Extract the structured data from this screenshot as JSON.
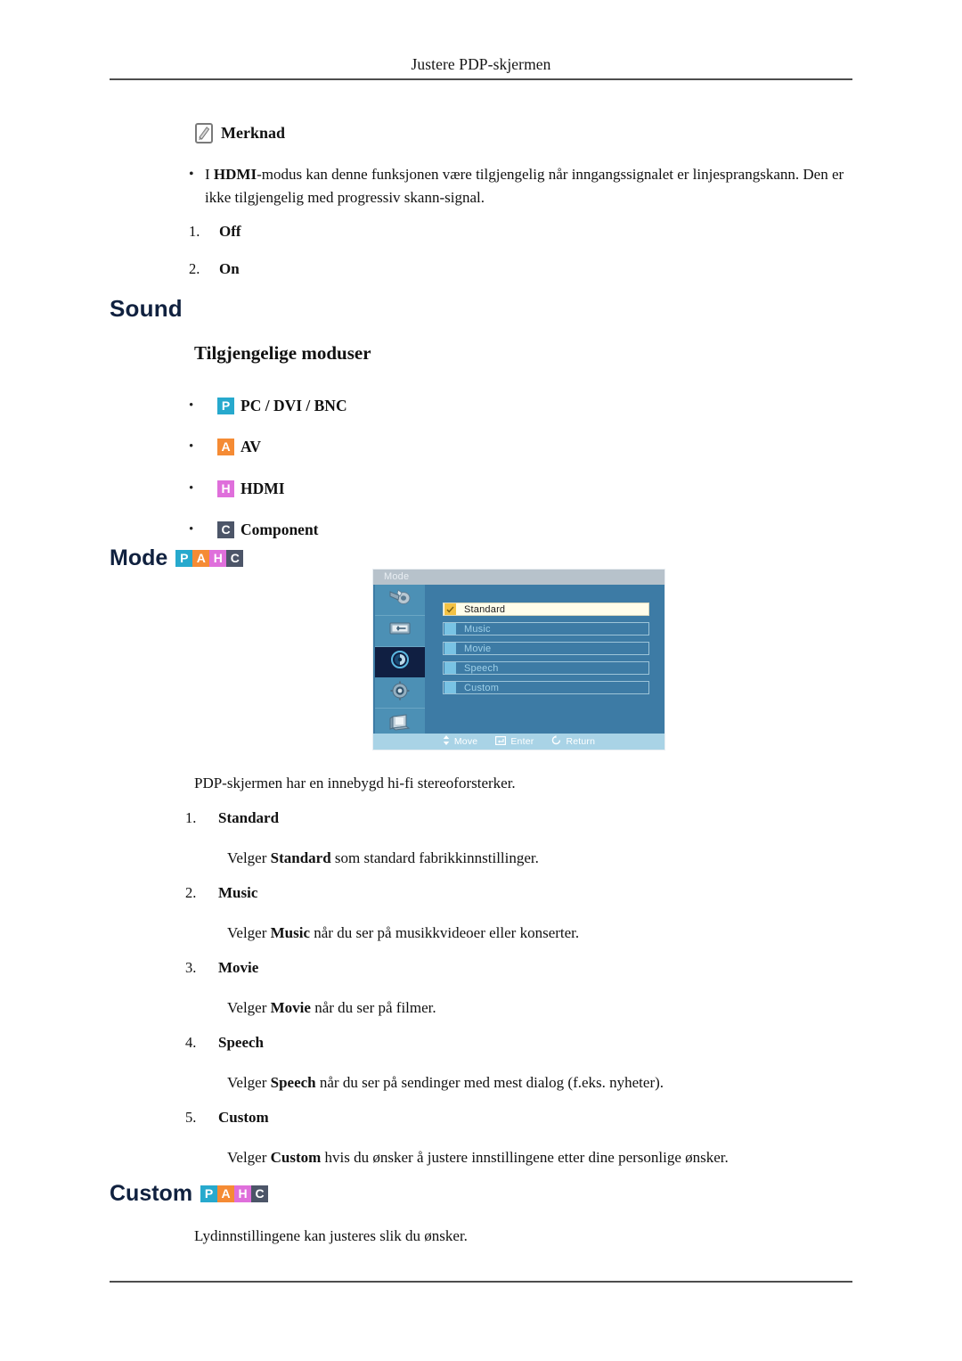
{
  "page": {
    "running_header": "Justere PDP-skjermen"
  },
  "note": {
    "icon": "note-pencil-icon",
    "label": "Merknad",
    "bullet": "I HDMI-modus kan denne funksjonen være tilgjengelig når inngangssignalet er linjesprangskann. Den er ikke tilgjengelig med progressiv skann-signal.",
    "bullet_bold_term": "HDMI",
    "options": [
      {
        "index": "1.",
        "label": "Off"
      },
      {
        "index": "2.",
        "label": "On"
      }
    ]
  },
  "sound_section": {
    "heading": "Sound",
    "subheading": "Tilgjengelige moduser",
    "available_modes": [
      {
        "badge": "P",
        "badge_color": "#27a9cd",
        "label": "PC / DVI / BNC"
      },
      {
        "badge": "A",
        "badge_color": "#f58b34",
        "label": "AV"
      },
      {
        "badge": "H",
        "badge_color": "#df6fdb",
        "label": "HDMI"
      },
      {
        "badge": "C",
        "badge_color": "#4c5568",
        "label": "Component"
      }
    ]
  },
  "mode_section": {
    "heading": "Mode",
    "badges": [
      {
        "letter": "P",
        "color": "#27a9cd"
      },
      {
        "letter": "A",
        "color": "#f58b34"
      },
      {
        "letter": "H",
        "color": "#df6fdb"
      },
      {
        "letter": "C",
        "color": "#4c5568"
      }
    ],
    "osd": {
      "title": "Mode",
      "sidebar_icons": [
        {
          "name": "picture-brush-icon",
          "active": false
        },
        {
          "name": "screen-display-icon",
          "active": false
        },
        {
          "name": "sound-speaker-icon",
          "active": true
        },
        {
          "name": "setup-gear-icon",
          "active": false
        },
        {
          "name": "multi-control-monitor-icon",
          "active": false
        }
      ],
      "items": [
        {
          "label": "Standard",
          "selected": true
        },
        {
          "label": "Music",
          "selected": false
        },
        {
          "label": "Movie",
          "selected": false
        },
        {
          "label": "Speech",
          "selected": false
        },
        {
          "label": "Custom",
          "selected": false
        }
      ],
      "footer": [
        {
          "icon": "move-updown-icon",
          "label": "Move"
        },
        {
          "icon": "enter-key-icon",
          "label": "Enter"
        },
        {
          "icon": "return-arrow-icon",
          "label": "Return"
        }
      ]
    },
    "intro": "PDP-skjermen har en innebygd hi-fi stereoforsterker.",
    "entries": [
      {
        "index": "1.",
        "title": "Standard",
        "desc_prefix": "Velger ",
        "desc_bold": "Standard",
        "desc_suffix": " som standard fabrikkinnstillinger."
      },
      {
        "index": "2.",
        "title": "Music",
        "desc_prefix": "Velger ",
        "desc_bold": "Music",
        "desc_suffix": " når du ser på musikkvideoer eller konserter."
      },
      {
        "index": "3.",
        "title": "Movie",
        "desc_prefix": "Velger ",
        "desc_bold": "Movie",
        "desc_suffix": " når du ser på filmer."
      },
      {
        "index": "4.",
        "title": "Speech",
        "desc_prefix": "Velger ",
        "desc_bold": "Speech",
        "desc_suffix": " når du ser på sendinger med mest dialog (f.eks. nyheter)."
      },
      {
        "index": "5.",
        "title": "Custom",
        "desc_prefix": "Velger ",
        "desc_bold": "Custom",
        "desc_suffix": " hvis du ønsker å justere innstillingene etter dine personlige ønsker."
      }
    ]
  },
  "custom_section": {
    "heading": "Custom",
    "badges": [
      {
        "letter": "P",
        "color": "#27a9cd"
      },
      {
        "letter": "A",
        "color": "#f58b34"
      },
      {
        "letter": "H",
        "color": "#df6fdb"
      },
      {
        "letter": "C",
        "color": "#4c5568"
      }
    ],
    "body": "Lydinnstillingene kan justeres slik du ønsker."
  }
}
